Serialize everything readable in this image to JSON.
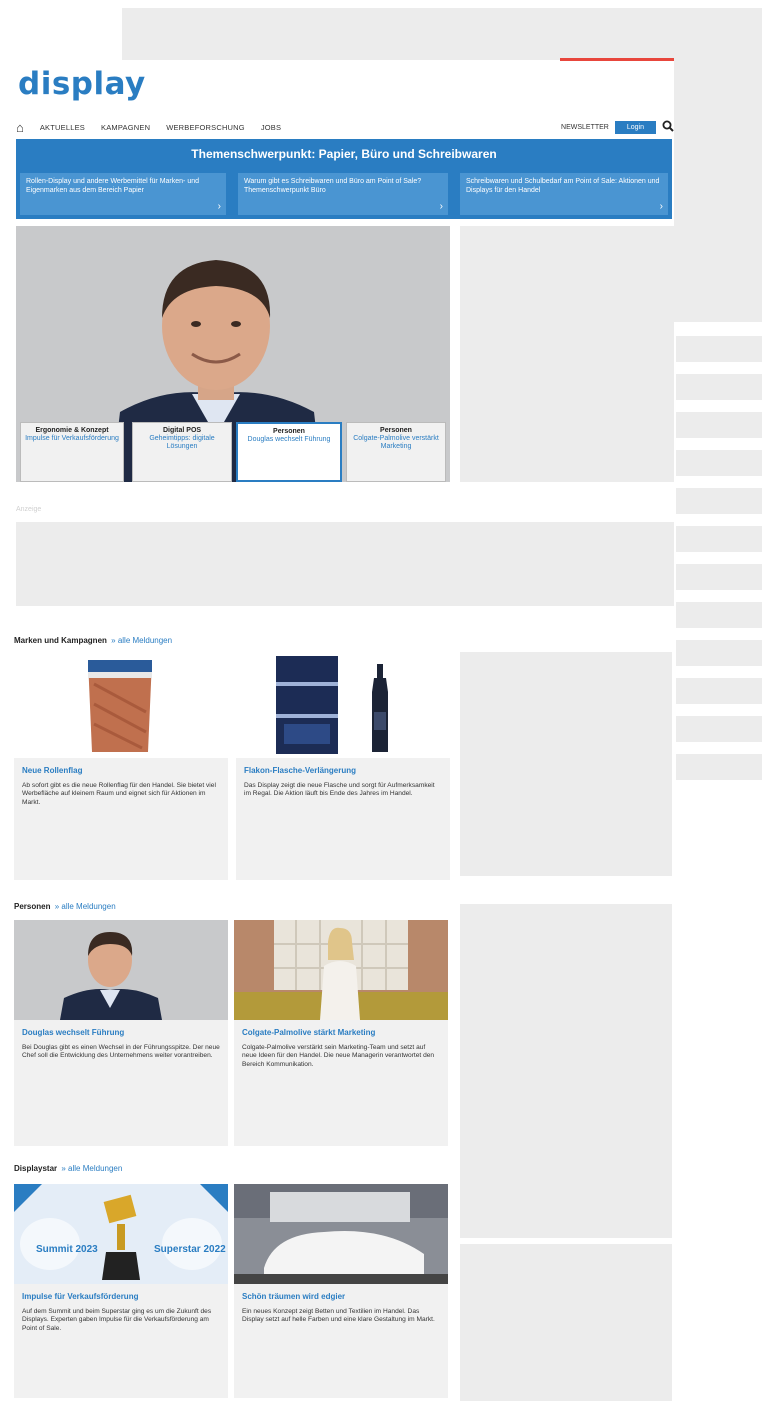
{
  "header": {
    "logo": "display",
    "nav": [
      "Aktuelles",
      "Kampagnen",
      "Werbeforschung",
      "Jobs"
    ],
    "newsletter": "Newsletter",
    "login": "Login"
  },
  "focus": {
    "title": "Themenschwerpunkt: Papier, Büro und Schreibwaren",
    "boxes": [
      {
        "text": "Rollen-Display und andere Werbemittel für Marken- und Eigenmarken aus dem Bereich Papier"
      },
      {
        "text": "Warum gibt es Schreibwaren und Büro am Point of Sale? Themenschwerpunkt Büro"
      },
      {
        "text": "Schreibwaren und Schulbedarf am Point of Sale: Aktionen und Displays für den Handel"
      }
    ]
  },
  "hero": {
    "tabs": [
      {
        "kicker": "Ergonomie & Konzept",
        "headline": "Impulse für Verkaufsförderung"
      },
      {
        "kicker": "Digital POS",
        "headline": "Geheimtipps: digitale Lösungen"
      },
      {
        "kicker": "Personen",
        "headline": "Douglas wechselt Führung"
      },
      {
        "kicker": "Personen",
        "headline": "Colgate-Palmolive verstärkt Marketing"
      }
    ]
  },
  "billboard": {
    "label": "Anzeige"
  },
  "sections": {
    "campaigns": {
      "heading": "Marken und Kampagnen",
      "more": "» alle Meldungen",
      "cards": [
        {
          "title": "Neue Rollenflag",
          "teaser": "Ab sofort gibt es die neue Rollenflag für den Handel. Sie bietet viel Werbefläche auf kleinem Raum und eignet sich für Aktionen im Markt."
        },
        {
          "title": "Flakon-Flasche-Verlängerung",
          "teaser": "Das Display zeigt die neue Flasche und sorgt für Aufmerksamkeit im Regal. Die Aktion läuft bis Ende des Jahres im Handel."
        }
      ]
    },
    "people": {
      "heading": "Personen",
      "more": "» alle Meldungen",
      "cards": [
        {
          "title": "Douglas wechselt Führung",
          "teaser": "Bei Douglas gibt es einen Wechsel in der Führungsspitze. Der neue Chef soll die Entwicklung des Unternehmens weiter vorantreiben."
        },
        {
          "title": "Colgate-Palmolive stärkt Marketing",
          "teaser": "Colgate-Palmolive verstärkt sein Marketing-Team und setzt auf neue Ideen für den Handel. Die neue Managerin verantwortet den Bereich Kommunikation."
        }
      ]
    },
    "display": {
      "heading": "Displaystar",
      "more": "» alle Meldungen",
      "cards": [
        {
          "title": "Impulse für Verkaufsförderung",
          "teaser": "Auf dem Summit und beim Superstar ging es um die Zukunft des Displays. Experten gaben Impulse für die Verkaufsförderung am Point of Sale."
        },
        {
          "title": "Schön träumen wird edgier",
          "teaser": "Ein neues Konzept zeigt Betten und Textilien im Handel. Das Display setzt auf helle Farben und eine klare Gestaltung im Markt."
        }
      ],
      "badges": [
        "Summit 2023",
        "Superstar 2022"
      ]
    }
  }
}
